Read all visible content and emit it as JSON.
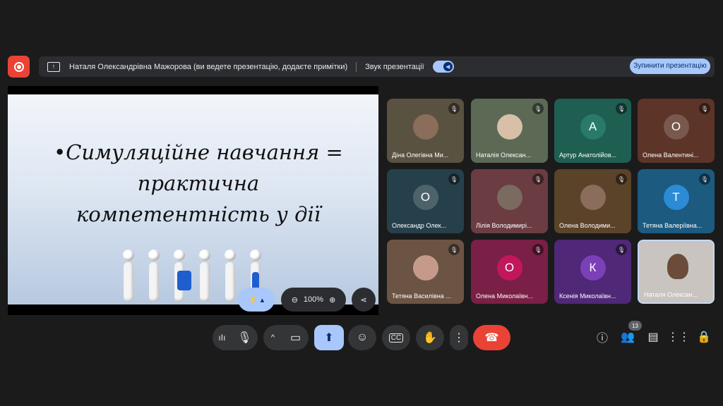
{
  "banner": {
    "presenter_text": "Наталя Олександрівна Мажорова (ви ведете презентацію, додаєте примітки)",
    "sound_label": "Звук презентації",
    "stop_label": "Зупинити презентацію"
  },
  "slide": {
    "line1": "•Симуляційне навчання =",
    "line2": "практична",
    "line3": "компетентність у дії",
    "zoom": "100%"
  },
  "tiles": [
    {
      "name": "Діна Олегівна Ми...",
      "avatar": "",
      "bg": "#5a5240"
    },
    {
      "name": "Наталія Олексан...",
      "avatar": "",
      "bg": "#5c6a55"
    },
    {
      "name": "Артур Анатолійов...",
      "avatar": "А",
      "bg": "#1f5f52"
    },
    {
      "name": "Олена Валентині...",
      "avatar": "О",
      "bg": "#5c3428"
    },
    {
      "name": "Олександр Олек...",
      "avatar": "О",
      "bg": "#26404b"
    },
    {
      "name": "Лілія Володимирі...",
      "avatar": "",
      "bg": "#6b3c42"
    },
    {
      "name": "Олена Володими...",
      "avatar": "",
      "bg": "#5b4329"
    },
    {
      "name": "Тетяна Валеріївна...",
      "avatar": "Т",
      "bg": "#1c5a80"
    },
    {
      "name": "Тетяна Василівна ...",
      "avatar": "",
      "bg": "#6c5444"
    },
    {
      "name": "Олена Миколаївн...",
      "avatar": "О",
      "bg": "#7a1f45"
    },
    {
      "name": "Ксенія Миколаївн...",
      "avatar": "К",
      "bg": "#4f2878"
    },
    {
      "name": "Наталя Олексан...",
      "avatar": "",
      "bg": "#c9c4bf"
    }
  ],
  "people_count": "13",
  "colors": {
    "accent": "#a8c7fa",
    "end_call": "#ea4335",
    "record": "#ea4335"
  }
}
